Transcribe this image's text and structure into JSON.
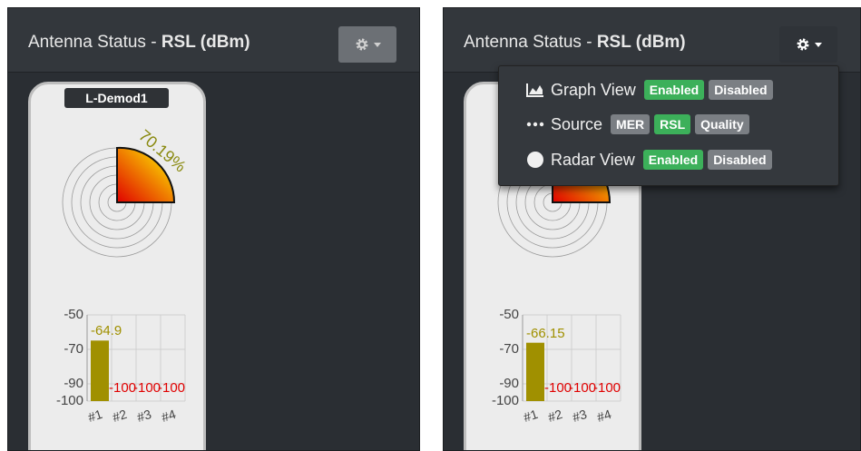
{
  "left_panel": {
    "title_prefix": "Antenna Status - ",
    "title_bold": "RSL (dBm)",
    "device": "L-Demod1",
    "percent": "70.19%",
    "bars": {
      "y_ticks": [
        "-50",
        "-70",
        "-90",
        "-100"
      ],
      "values": [
        -64.9,
        -100,
        -100,
        -100
      ],
      "value_labels": [
        "-64.9",
        "-100",
        "-100",
        "-100"
      ],
      "x_labels": [
        "#1",
        "#2",
        "#3",
        "#4"
      ]
    }
  },
  "right_panel": {
    "title_prefix": "Antenna Status - ",
    "title_bold": "RSL (dBm)",
    "bars": {
      "y_ticks": [
        "-50",
        "-70",
        "-90",
        "-100"
      ],
      "values": [
        -66.15,
        -100,
        -100,
        -100
      ],
      "value_labels": [
        "-66.15",
        "-100",
        "-100",
        "-100"
      ],
      "x_labels": [
        "#1",
        "#2",
        "#3",
        "#4"
      ]
    },
    "menu": {
      "graph_view": {
        "label": "Graph View",
        "icon": "area-chart-icon",
        "enabled": "Enabled",
        "disabled": "Disabled",
        "selected": "Enabled"
      },
      "source": {
        "label": "Source",
        "icon": "ellipsis-icon",
        "options": [
          "MER",
          "RSL",
          "Quality"
        ],
        "selected": "RSL"
      },
      "radar_view": {
        "label": "Radar View",
        "icon": "circle-icon",
        "enabled": "Enabled",
        "disabled": "Disabled",
        "selected": "Enabled"
      }
    }
  },
  "colors": {
    "accent_green": "#3cb05a",
    "bar_olive": "#a09000",
    "value_red": "#e00000",
    "inactive_gray": "#7b7f84"
  }
}
